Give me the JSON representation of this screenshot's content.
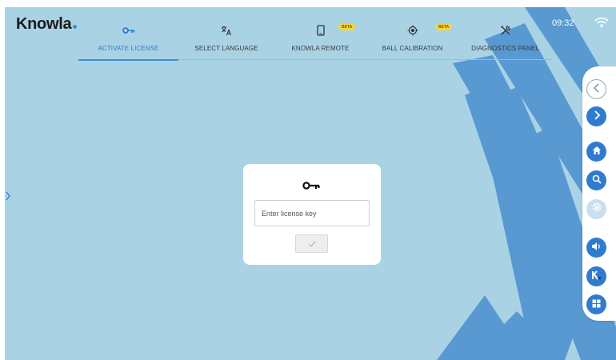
{
  "app": {
    "logo": "Knowla",
    "time": "09:32"
  },
  "tabs": [
    {
      "label": "ACTIVATE LICENSE",
      "icon": "key-icon",
      "active": true
    },
    {
      "label": "SELECT LANGUAGE",
      "icon": "translate-icon"
    },
    {
      "label": "KNOWLA REMOTE",
      "icon": "phone-icon",
      "badge": "BETA"
    },
    {
      "label": "BALL CALIBRATION",
      "icon": "target-icon",
      "badge": "BETA"
    },
    {
      "label": "DIAGNOSTICS PANEL",
      "icon": "tools-icon"
    }
  ],
  "license": {
    "placeholder": "Enter license key",
    "submit_icon": "check-icon"
  },
  "dock": [
    "back-icon",
    "forward-icon",
    "home-icon",
    "search-icon",
    "settings-icon",
    "volume-icon",
    "knowla-k-icon",
    "windows-icon"
  ],
  "colors": {
    "background": "#a9d3e4",
    "accent": "#2f7bd0",
    "brush": "#4a8fcf",
    "beta_badge": "#f5d53a"
  }
}
